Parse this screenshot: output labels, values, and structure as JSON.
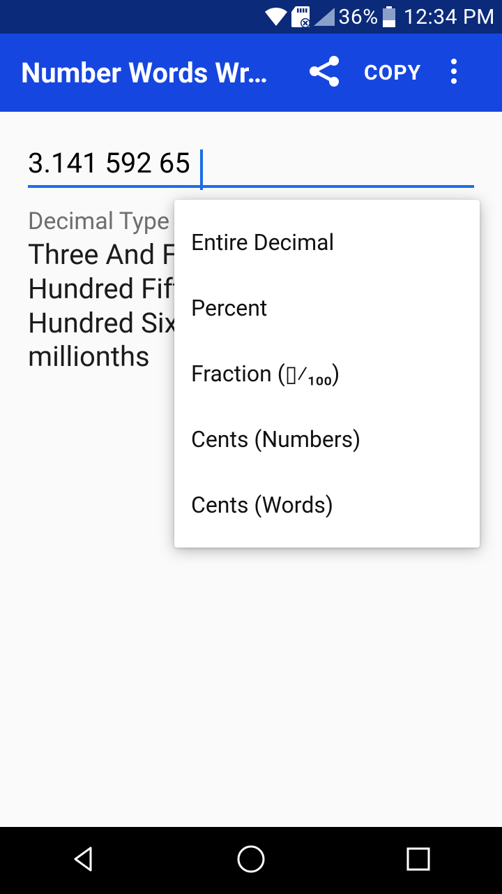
{
  "status": {
    "battery_pct": "36%",
    "time": "12:34 PM"
  },
  "appbar": {
    "title": "Number Words Wr…",
    "copy_label": "COPY"
  },
  "input": {
    "value": "3.141 592 65"
  },
  "section_label": "Decimal Type",
  "result_text": "Three And Fourteen Million, One Hundred Fifty-nine Thousand, Two Hundred Sixty-five Hundred-millionths",
  "dropdown": {
    "items": [
      "Entire Decimal",
      "Percent",
      "Fraction (▯⁄₁₀₀)",
      "Cents (Numbers)",
      "Cents (Words)"
    ]
  }
}
